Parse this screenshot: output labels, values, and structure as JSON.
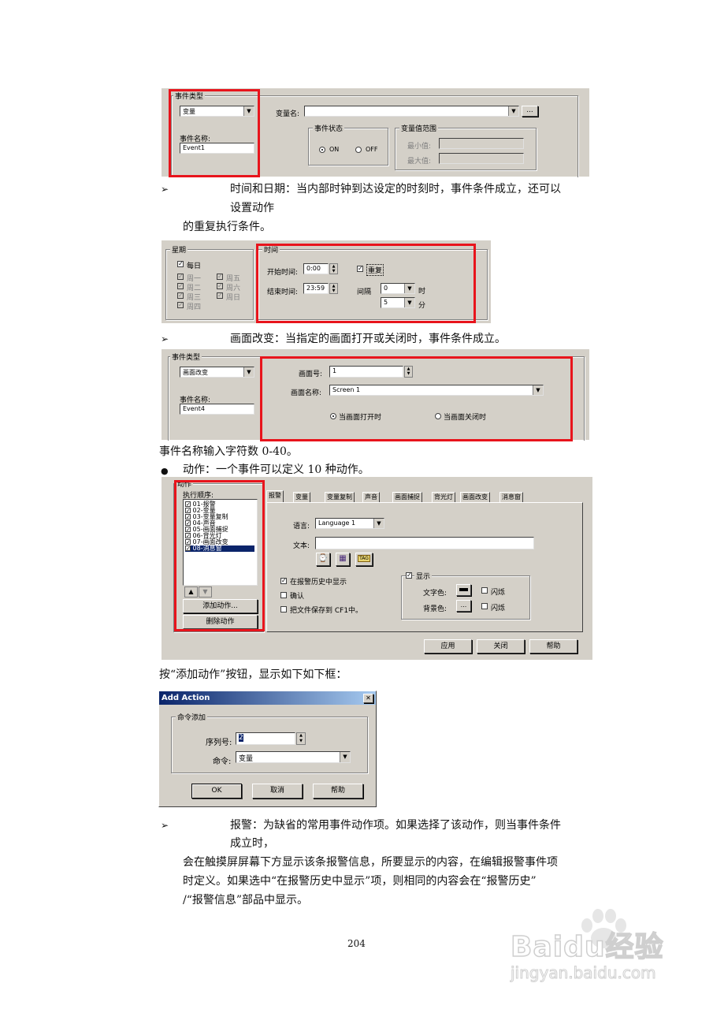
{
  "fig1": {
    "group_event_type": "事件类型",
    "type_value": "变量",
    "var_name_label": "变量名:",
    "browse_label": "...",
    "event_name_label": "事件名称:",
    "event_name_value": "Event1",
    "event_state_group": "事件状态",
    "on_label": "ON",
    "off_label": "OFF",
    "range_group": "变量值范围",
    "min_label": "最小值:",
    "max_label": "最大值:"
  },
  "p1": {
    "bullet": "➢",
    "line1": "时间和日期：当内部时钟到达设定的时刻时，事件条件成立，还可以",
    "line2": "设置动作",
    "line3": "的重复执行条件。"
  },
  "fig2": {
    "week_group": "星期",
    "every_day": "每日",
    "days": [
      "周一",
      "周二",
      "周三",
      "周四",
      "周五",
      "周六",
      "周日"
    ],
    "time_group": "时间",
    "start_label": "开始时间:",
    "start_value": "0:00",
    "end_label": "结束时间:",
    "end_value": "23:59",
    "repeat_label": "重复",
    "interval_label": "间隔",
    "hour_value": "0",
    "hour_unit": "时",
    "min_value": "5",
    "min_unit": "分"
  },
  "p2": {
    "bullet": "➢",
    "line1": "画面改变：当指定的画面打开或关闭时，事件条件成立。"
  },
  "fig3": {
    "group_event_type": "事件类型",
    "type_value": "画面改变",
    "event_name_label": "事件名称:",
    "event_name_value": "Event4",
    "screen_no_label": "画面号:",
    "screen_no_value": "1",
    "screen_name_label": "画面名称:",
    "screen_name_value": "Screen 1",
    "open_label": "当画面打开时",
    "close_label": "当画面关闭时"
  },
  "p3": {
    "line1": "事件名称输入字符数 0-40。",
    "bullet": "●",
    "line2": "动作：一个事件可以定义 10 种动作。"
  },
  "fig4": {
    "group_action": "动作",
    "order_label": "执行顺序:",
    "items": [
      "01-报警",
      "02-变量",
      "03-变量复制",
      "04-声音",
      "05-画面捕捉",
      "06-背光灯",
      "07-画面改变",
      "08-消息窗"
    ],
    "up_arrow": "▲",
    "down_arrow": "▼",
    "add_btn": "添加动作...",
    "del_btn": "删除动作",
    "tabs": [
      "报警",
      "变量",
      "变量复制",
      "声音",
      "画面捕捉",
      "背光灯",
      "画面改变",
      "消息窗"
    ],
    "lang_label": "语言:",
    "lang_value": "Language 1",
    "text_label": "文本:",
    "icon_tags": [
      "⌚",
      "▦",
      "TAG"
    ],
    "history_label": "在报警历史中显示",
    "confirm_label": "确认",
    "save_label": "把文件保存到 CF1中。",
    "show_label": "显示",
    "fg_label": "文字色:",
    "bg_label": "背景色:",
    "blink_label": "闪烁",
    "apply_btn": "应用",
    "close_btn": "关闭",
    "help_btn": "帮助",
    "bg_btn_label": "..."
  },
  "p4": {
    "line1": "按“添加动作”按钮，显示如下如下框："
  },
  "fig5": {
    "title": "Add Action",
    "close": "✕",
    "group_label": "命令添加",
    "seq_label": "序列号:",
    "seq_value": "2",
    "cmd_label": "命令:",
    "cmd_value": "变量",
    "ok_btn": "OK",
    "cancel_btn": "取消",
    "help_btn": "帮助"
  },
  "p5": {
    "bullet": "➢",
    "line1": "报警：为缺省的常用事件动作项。如果选择了该动作，则当事件条件",
    "line2": "成立时，",
    "line3": "会在触摸屏屏幕下方显示该条报警信息，所要显示的内容，在编辑报警事件项",
    "line4": "时定义。如果选中“在报警历史中显示”项，则相同的内容会在“报警历史”",
    "line5": "/“报警信息”部品中显示。"
  },
  "page_number": "204",
  "watermark": {
    "brand": "Baidu经验",
    "url": "jingyan.baidu.com"
  }
}
